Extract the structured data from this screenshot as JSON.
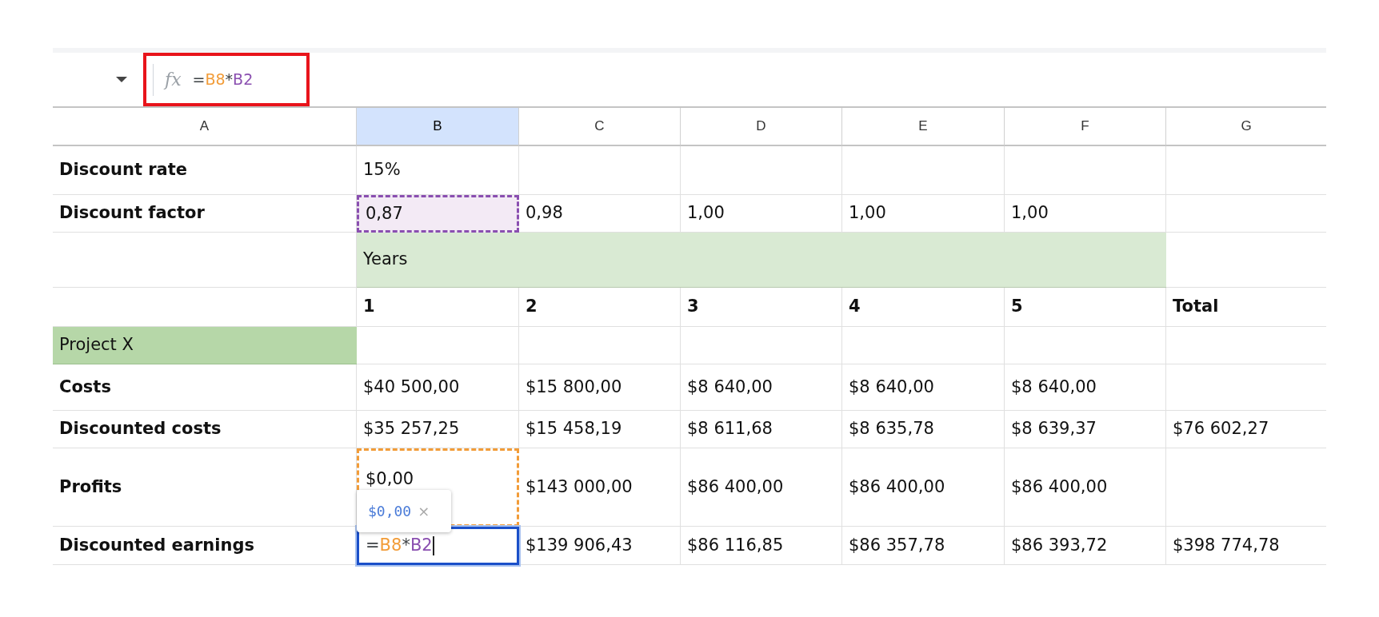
{
  "formula_bar": {
    "function_label": "fx",
    "tokens": [
      {
        "text": "=",
        "color": "#3c4043"
      },
      {
        "text": "B8",
        "color": "#f29c38"
      },
      {
        "text": "*",
        "color": "#3c4043"
      },
      {
        "text": "B2",
        "color": "#8a4fb0"
      }
    ]
  },
  "columns": [
    {
      "label": "A",
      "selected": false
    },
    {
      "label": "B",
      "selected": true
    },
    {
      "label": "C",
      "selected": false
    },
    {
      "label": "D",
      "selected": false
    },
    {
      "label": "E",
      "selected": false
    },
    {
      "label": "F",
      "selected": false
    },
    {
      "label": "G",
      "selected": false
    }
  ],
  "rows": [
    {
      "cells": [
        {
          "text": "Discount rate",
          "bold": true
        },
        {
          "text": "15%",
          "bold": false
        },
        {},
        {},
        {},
        {},
        {}
      ]
    },
    {
      "cells": [
        {
          "text": "Discount factor",
          "bold": true
        },
        {
          "kind": "reference",
          "text": "0,87",
          "bold": false,
          "color": "#8a4fb0"
        },
        {
          "text": "0,98",
          "bold": false
        },
        {
          "text": "1,00",
          "bold": false
        },
        {
          "text": "1,00",
          "bold": false
        },
        {
          "text": "1,00",
          "bold": false
        },
        {}
      ]
    },
    {
      "cells": [
        {},
        {
          "kind": "band",
          "text": "Years",
          "bold": false
        },
        {}
      ]
    },
    {
      "cells": [
        {},
        {
          "text": "1",
          "bold": true
        },
        {
          "text": "2",
          "bold": true
        },
        {
          "text": "3",
          "bold": true
        },
        {
          "text": "4",
          "bold": true
        },
        {
          "text": "5",
          "bold": true
        },
        {
          "text": "Total",
          "bold": true
        }
      ]
    },
    {
      "cells": [
        {
          "kind": "category",
          "text": "Project X",
          "bold": false
        },
        {},
        {},
        {},
        {},
        {},
        {}
      ]
    },
    {
      "cells": [
        {
          "text": "Costs",
          "bold": true
        },
        {
          "text": "$40 500,00",
          "bold": false
        },
        {
          "text": "$15 800,00",
          "bold": false
        },
        {
          "text": "$8 640,00",
          "bold": false
        },
        {
          "text": "$8 640,00",
          "bold": false
        },
        {
          "text": "$8 640,00",
          "bold": false
        },
        {}
      ]
    },
    {
      "cells": [
        {
          "text": "Discounted costs",
          "bold": true
        },
        {
          "text": "$35 257,25",
          "bold": false
        },
        {
          "text": "$15 458,19",
          "bold": false
        },
        {
          "text": "$8 611,68",
          "bold": false
        },
        {
          "text": "$8 635,78",
          "bold": false
        },
        {
          "text": "$8 639,37",
          "bold": false
        },
        {
          "text": "$76 602,27",
          "bold": false
        }
      ]
    },
    {
      "cells": [
        {
          "text": "Profits",
          "bold": true
        },
        {
          "kind": "reference",
          "text": "$0,00",
          "bold": false,
          "color": "#f29c38"
        },
        {
          "text": "$143 000,00",
          "bold": false
        },
        {
          "text": "$86 400,00",
          "bold": false
        },
        {
          "text": "$86 400,00",
          "bold": false
        },
        {
          "text": "$86 400,00",
          "bold": false
        },
        {}
      ]
    },
    {
      "cells": [
        {
          "text": "Discounted earnings",
          "bold": true
        },
        {
          "kind": "editing",
          "tokens": [
            {
              "text": "=",
              "color": "#3c4043"
            },
            {
              "text": "B8",
              "color": "#f29c38"
            },
            {
              "text": "*",
              "color": "#3c4043"
            },
            {
              "text": "B2",
              "color": "#8a4fb0"
            }
          ]
        },
        {
          "text": "$139 906,43",
          "bold": false
        },
        {
          "text": "$86 116,85",
          "bold": false
        },
        {
          "text": "$86 357,78",
          "bold": false
        },
        {
          "text": "$86 393,72",
          "bold": false
        },
        {
          "text": "$398 774,78",
          "bold": false
        }
      ]
    }
  ],
  "preview": {
    "value": "$0,00",
    "close": "×"
  }
}
